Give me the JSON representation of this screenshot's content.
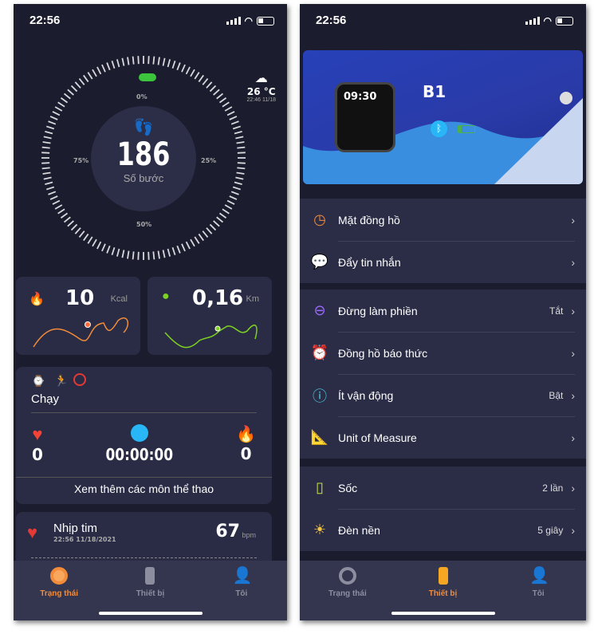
{
  "status": {
    "time": "22:56"
  },
  "home": {
    "steps": {
      "value": "186",
      "label": "Số bước",
      "ticks": [
        "0%",
        "25%",
        "50%",
        "75%"
      ]
    },
    "weather": {
      "temp": "26 °C",
      "updated": "22:46 11/18",
      "icon": "cloud-icon"
    },
    "calories": {
      "value": "10",
      "unit": "Kcal"
    },
    "distance": {
      "value": "0,16",
      "unit": "Km"
    },
    "sport": {
      "name": "Chạy",
      "heart": "0",
      "duration": "00:00:00",
      "calories": "0",
      "more": "Xem thêm các môn thể thao"
    },
    "heart_rate": {
      "title": "Nhịp tim",
      "time": "22:56 11/18/2021",
      "value": "67",
      "unit": "bpm"
    }
  },
  "tabs": [
    {
      "label": "Trạng thái"
    },
    {
      "label": "Thiết bị"
    },
    {
      "label": "Tôi"
    }
  ],
  "device": {
    "name": "B1",
    "watch_time": "09:30",
    "groups": [
      [
        {
          "label": "Mặt đồng hồ",
          "icon": "watch-face-icon",
          "value": ""
        },
        {
          "label": "Đẩy tin nhắn",
          "icon": "message-icon",
          "value": ""
        }
      ],
      [
        {
          "label": "Đừng làm phiền",
          "icon": "do-not-disturb-icon",
          "value": "Tắt"
        },
        {
          "label": "Đồng hồ báo thức",
          "icon": "alarm-clock-icon",
          "value": ""
        },
        {
          "label": "Ít vận động",
          "icon": "sedentary-icon",
          "value": "Bật"
        },
        {
          "label": "Unit of Measure",
          "icon": "ruler-icon",
          "value": ""
        }
      ],
      [
        {
          "label": "Sốc",
          "icon": "vibration-icon",
          "value": "2 lần"
        },
        {
          "label": "Đèn nền",
          "icon": "backlight-icon",
          "value": "5 giây"
        }
      ]
    ]
  },
  "colors": {
    "accent": "#f28b3a",
    "bg": "#1b1c2d",
    "card": "#2a2c45"
  }
}
